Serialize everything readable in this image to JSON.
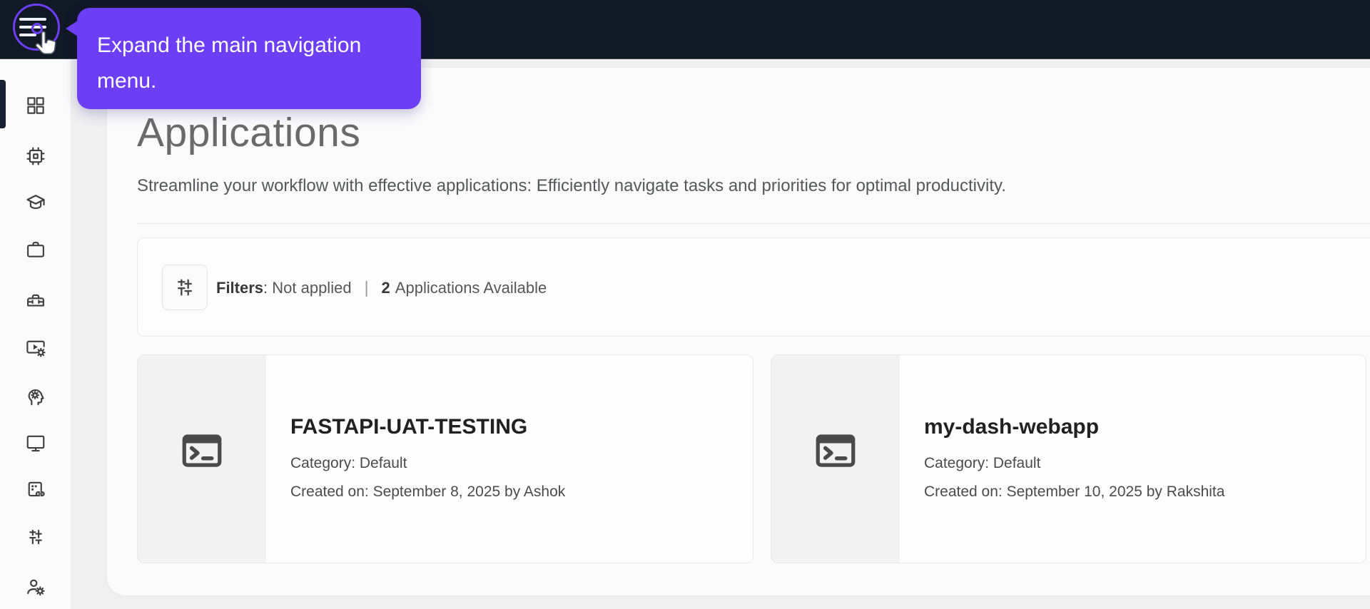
{
  "colors": {
    "accent_purple": "#6c3ef6",
    "topbar_bg": "#111826",
    "sidebar_icon_gray": "#3e3e3e",
    "page_bg": "#f0f0f1",
    "panel_bg": "#fbfbfc",
    "card_border": "#e9e9eb",
    "terminal_icon_gray": "#4a4a4a"
  },
  "topbar": {
    "menu_icon": "hamburger-menu-icon"
  },
  "coach_tooltip": {
    "text": "Expand the main navigation menu."
  },
  "sidebar": {
    "active_index": 0,
    "items": [
      {
        "icon": "grid-icon"
      },
      {
        "icon": "chip-icon"
      },
      {
        "icon": "graduation-cap-icon"
      },
      {
        "icon": "briefcase-icon"
      },
      {
        "icon": "toolbox-icon"
      },
      {
        "icon": "video-settings-icon"
      },
      {
        "icon": "psychology-icon"
      },
      {
        "icon": "monitor-icon"
      },
      {
        "icon": "card-link-icon"
      },
      {
        "icon": "sliders-icon"
      },
      {
        "icon": "user-gear-icon"
      }
    ]
  },
  "page": {
    "title": "Applications",
    "subtitle": "Streamline your workflow with effective applications: Efficiently navigate tasks and priorities for optimal productivity."
  },
  "filters": {
    "icon": "filter-sliders-icon",
    "label": "Filters",
    "status_text": ": Not applied",
    "separator": "|",
    "count": "2",
    "count_label": "Applications Available"
  },
  "applications": [
    {
      "icon": "terminal-icon",
      "name": "FASTAPI-UAT-TESTING",
      "category_line": "Category: Default",
      "created_line": "Created on: September 8, 2025 by Ashok"
    },
    {
      "icon": "terminal-icon",
      "name": "my-dash-webapp",
      "category_line": "Category: Default",
      "created_line": "Created on: September 10, 2025 by Rakshita"
    }
  ]
}
